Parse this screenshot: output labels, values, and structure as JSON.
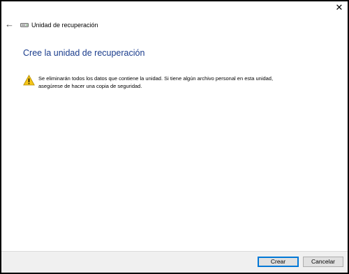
{
  "window": {
    "title": "Unidad de recuperación",
    "close_glyph": "✕",
    "back_glyph": "←"
  },
  "main": {
    "heading": "Cree la unidad de recuperación",
    "warning": "Se eliminarán todos los datos que contiene la unidad. Si tiene algún archivo personal en esta unidad, asegúrese de hacer una copia de seguridad."
  },
  "footer": {
    "create_label": "Crear",
    "cancel_label": "Cancelar"
  },
  "icons": {
    "back": "arrow-left-icon",
    "close": "close-icon",
    "drive": "drive-icon",
    "warning": "warning-icon"
  },
  "colors": {
    "heading": "#1a3c8c",
    "warning_fill": "#f5c518",
    "primary_border": "#0078d7",
    "footer_bg": "#f0f0f0"
  }
}
